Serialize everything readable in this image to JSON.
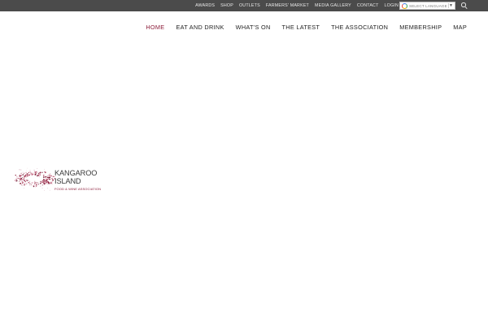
{
  "topbar": {
    "links": [
      "AWARDS",
      "SHOP",
      "OUTLETS",
      "FARMERS' MARKET",
      "MEDIA GALLERY",
      "CONTACT",
      "LOGIN"
    ],
    "language_select": "SELECT LANGUAGE",
    "language_arrow": "▼",
    "search_icon": "search-icon",
    "background": "#4b4b4b"
  },
  "nav": {
    "items": [
      "HOME",
      "EAT AND DRINK",
      "WHAT'S ON",
      "THE LATEST",
      "THE ASSOCIATION",
      "MEMBERSHIP",
      "MAP"
    ],
    "active": "HOME",
    "accent": "#8c1d3a"
  },
  "logo": {
    "line1": "KANGAROO",
    "line2": "ISLAND",
    "subtitle": "FOOD & WINE ASSOCIATION",
    "mark_icon": "island-dots-icon"
  }
}
